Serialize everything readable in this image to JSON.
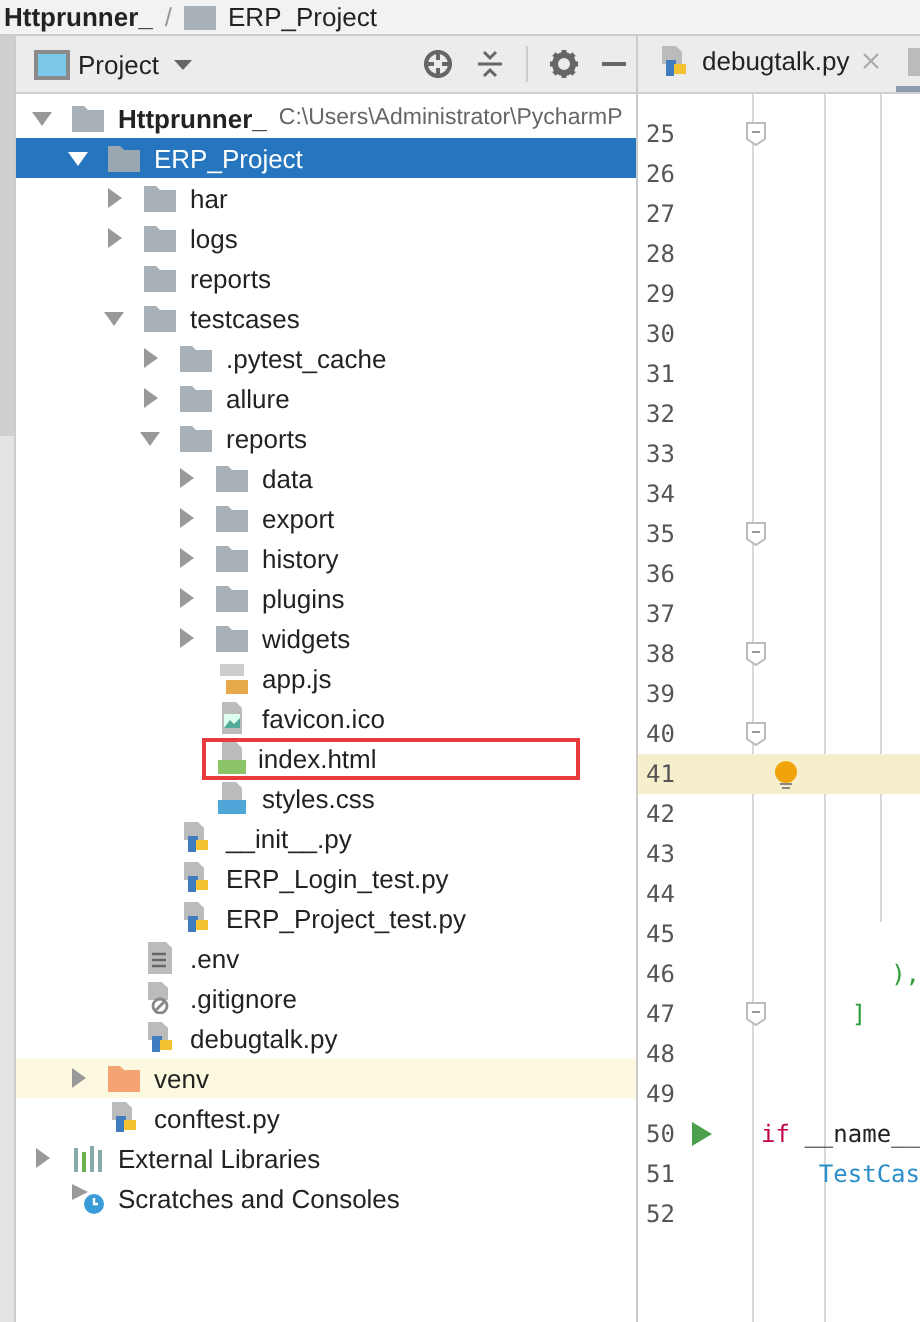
{
  "breadcrumb": [
    {
      "label": "Httprunner_",
      "kind": "module"
    },
    {
      "label": "/",
      "kind": "separator"
    },
    {
      "label": "ERP_Project",
      "kind": "folder"
    }
  ],
  "panel": {
    "title": "Project"
  },
  "tree": [
    {
      "label": "Httprunner_",
      "path": "C:\\Users\\Administrator\\PycharmP",
      "kind": "module",
      "expanded": true,
      "selected": false,
      "children": [
        {
          "label": "ERP_Project",
          "kind": "folder",
          "expanded": true,
          "selected": true,
          "children": [
            {
              "label": "har",
              "kind": "folder",
              "expanded": false,
              "selected": false
            },
            {
              "label": "logs",
              "kind": "folder",
              "expanded": false,
              "selected": false
            },
            {
              "label": "reports",
              "kind": "folder",
              "selected": false
            },
            {
              "label": "testcases",
              "kind": "folder",
              "expanded": true,
              "selected": false,
              "children": [
                {
                  "label": ".pytest_cache",
                  "kind": "folder",
                  "expanded": false,
                  "selected": false
                },
                {
                  "label": "allure",
                  "kind": "folder",
                  "expanded": false,
                  "selected": false
                },
                {
                  "label": "reports",
                  "kind": "folder",
                  "expanded": true,
                  "selected": false,
                  "children": [
                    {
                      "label": "data",
                      "kind": "folder",
                      "expanded": false,
                      "selected": false
                    },
                    {
                      "label": "export",
                      "kind": "folder",
                      "expanded": false,
                      "selected": false
                    },
                    {
                      "label": "history",
                      "kind": "folder",
                      "expanded": false,
                      "selected": false
                    },
                    {
                      "label": "plugins",
                      "kind": "folder",
                      "expanded": false,
                      "selected": false
                    },
                    {
                      "label": "widgets",
                      "kind": "folder",
                      "expanded": false,
                      "selected": false
                    },
                    {
                      "label": "app.js",
                      "kind": "js",
                      "selected": false
                    },
                    {
                      "label": "favicon.ico",
                      "kind": "image",
                      "selected": false
                    },
                    {
                      "label": "index.html",
                      "kind": "html",
                      "selected": false,
                      "marked": true
                    },
                    {
                      "label": "styles.css",
                      "kind": "css",
                      "selected": false
                    }
                  ]
                },
                {
                  "label": "__init__.py",
                  "kind": "python",
                  "selected": false
                },
                {
                  "label": "ERP_Login_test.py",
                  "kind": "python",
                  "selected": false
                },
                {
                  "label": "ERP_Project_test.py",
                  "kind": "python",
                  "selected": false
                }
              ]
            },
            {
              "label": ".env",
              "kind": "text",
              "selected": false
            },
            {
              "label": ".gitignore",
              "kind": "ignore",
              "selected": false
            },
            {
              "label": "debugtalk.py",
              "kind": "python",
              "selected": false
            }
          ]
        },
        {
          "label": "venv",
          "kind": "venv",
          "expanded": false,
          "selected": false,
          "highlighted": true
        },
        {
          "label": "conftest.py",
          "kind": "python",
          "selected": false
        }
      ]
    },
    {
      "label": "External Libraries",
      "kind": "libraries",
      "expanded": false,
      "selected": false
    },
    {
      "label": "Scratches and Consoles",
      "kind": "scratches",
      "selected": false
    }
  ],
  "editor": {
    "tabs": [
      {
        "label": "debugtalk.py",
        "selected": false
      }
    ],
    "lines": [
      {
        "number": "25",
        "fold": true
      },
      {
        "number": "26"
      },
      {
        "number": "27"
      },
      {
        "number": "28"
      },
      {
        "number": "29"
      },
      {
        "number": "30"
      },
      {
        "number": "31"
      },
      {
        "number": "32"
      },
      {
        "number": "33"
      },
      {
        "number": "34"
      },
      {
        "number": "35",
        "fold": true
      },
      {
        "number": "36"
      },
      {
        "number": "37"
      },
      {
        "number": "38",
        "fold": true
      },
      {
        "number": "39"
      },
      {
        "number": "40",
        "fold": true
      },
      {
        "number": "41",
        "current": true,
        "hint": true
      },
      {
        "number": "42"
      },
      {
        "number": "43"
      },
      {
        "number": "44"
      },
      {
        "number": "45"
      },
      {
        "number": "46",
        "code": [
          {
            "text": "        ),",
            "kind": "bracket"
          }
        ]
      },
      {
        "number": "47",
        "fold": true,
        "code": [
          {
            "text": "    ]",
            "kind": "bracket"
          }
        ]
      },
      {
        "number": "48"
      },
      {
        "number": "49"
      },
      {
        "number": "50",
        "run": true,
        "code": [
          {
            "text": "if",
            "kind": "keyword"
          },
          {
            "text": " __name__",
            "kind": "plain"
          }
        ]
      },
      {
        "number": "51",
        "code": [
          {
            "text": "    TestCas",
            "kind": "call"
          }
        ]
      },
      {
        "number": "52"
      }
    ]
  }
}
